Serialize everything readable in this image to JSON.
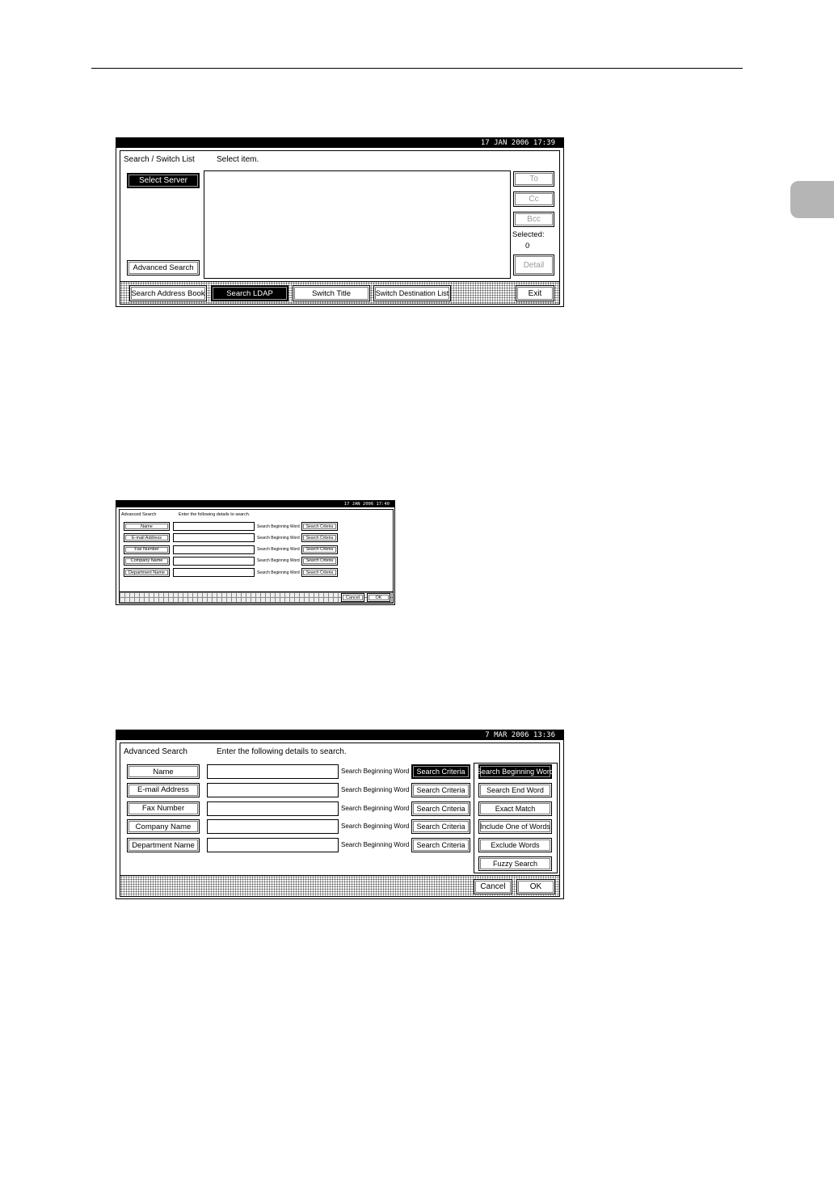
{
  "screen1": {
    "datetime": "17  JAN   2006 17:39",
    "title": "Search / Switch List",
    "instruction": "Select item.",
    "select_server": "Select Server",
    "advanced_search": "Advanced Search",
    "to": "To",
    "cc": "Cc",
    "bcc": "Bcc",
    "selected_label": "Selected:",
    "selected_count": "0",
    "detail": "Detail",
    "tabs": [
      "Search Address Book",
      "Search LDAP",
      "Switch Title",
      "Switch Destination List"
    ],
    "exit": "Exit"
  },
  "screen2": {
    "datetime": "17  JAN   2006 17:40",
    "title": "Advanced Search",
    "instruction": "Enter the following details to search.",
    "rows": [
      {
        "label": "Name",
        "mode": "Search Beginning Word",
        "criteria": "Search Criteria"
      },
      {
        "label": "E-mail Address",
        "mode": "Search Beginning Word",
        "criteria": "Search Criteria"
      },
      {
        "label": "Fax Number",
        "mode": "Search Beginning Word",
        "criteria": "Search Criteria"
      },
      {
        "label": "Company Name",
        "mode": "Search Beginning Word",
        "criteria": "Search Criteria"
      },
      {
        "label": "Department Name",
        "mode": "Search Beginning Word",
        "criteria": "Search Criteria"
      }
    ],
    "cancel": "Cancel",
    "ok": "OK"
  },
  "screen3": {
    "datetime": "7  MAR   2006 13:36",
    "title": "Advanced Search",
    "instruction": "Enter the following details to search.",
    "rows": [
      {
        "label": "Name",
        "mode": "Search Beginning Word",
        "criteria": "Search Criteria"
      },
      {
        "label": "E-mail Address",
        "mode": "Search Beginning Word",
        "criteria": "Search Criteria"
      },
      {
        "label": "Fax Number",
        "mode": "Search Beginning Word",
        "criteria": "Search Criteria"
      },
      {
        "label": "Company Name",
        "mode": "Search Beginning Word",
        "criteria": "Search Criteria"
      },
      {
        "label": "Department Name",
        "mode": "Search Beginning Word",
        "criteria": "Search Criteria"
      }
    ],
    "options": [
      "Search Beginning Word",
      "Search End Word",
      "Exact Match",
      "Include One of Words",
      "Exclude Words",
      "Fuzzy Search"
    ],
    "cancel": "Cancel",
    "ok": "OK"
  }
}
